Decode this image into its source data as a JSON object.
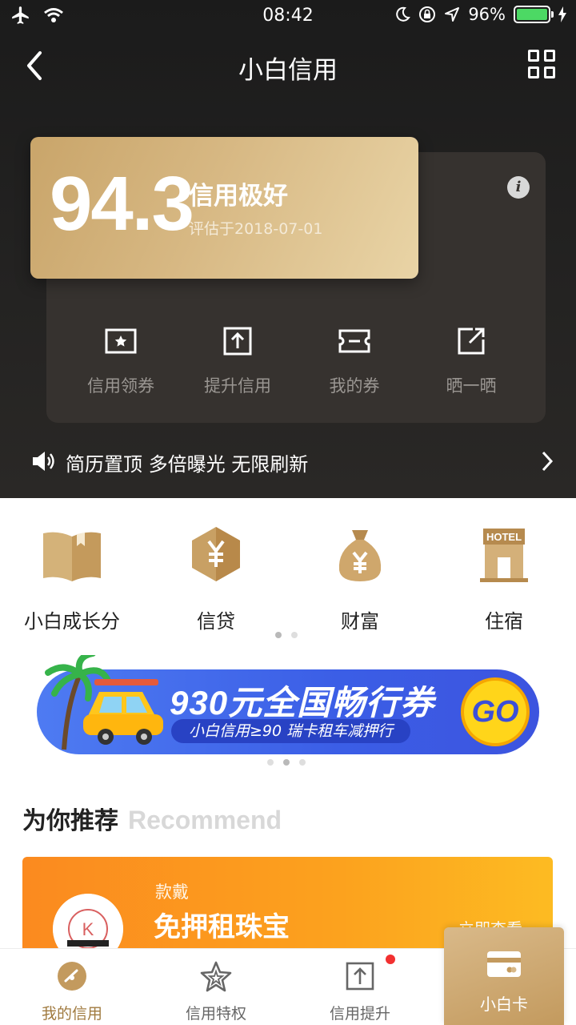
{
  "status_bar": {
    "time": "08:42",
    "battery": "96%"
  },
  "nav": {
    "title": "小白信用"
  },
  "credit": {
    "score": "94.3",
    "grade": "信用极好",
    "evaluated": "评估于2018-07-01"
  },
  "actions": [
    {
      "label": "信用领券",
      "icon": "coupon-star-icon"
    },
    {
      "label": "提升信用",
      "icon": "upload-icon"
    },
    {
      "label": "我的券",
      "icon": "ticket-icon"
    },
    {
      "label": "晒一晒",
      "icon": "share-icon"
    }
  ],
  "notice": {
    "text": "简历置顶 多倍曝光 无限刷新"
  },
  "services": [
    {
      "label": "小白成长分",
      "icon": "book-icon"
    },
    {
      "label": "信贷",
      "icon": "yuan-hexagon-icon"
    },
    {
      "label": "财富",
      "icon": "money-bag-icon"
    },
    {
      "label": "住宿",
      "icon": "hotel-icon",
      "sign": "HOTEL"
    }
  ],
  "banner": {
    "title": "930元全国畅行券",
    "subtitle": "小白信用≥90 瑞卡租车减押行",
    "button": "GO"
  },
  "recommend": {
    "title": "为你推荐",
    "title_en": "Recommend",
    "card": {
      "brand": "款戴",
      "name": "免押租珠宝",
      "action": "立即查看",
      "logo_letter": "K"
    }
  },
  "tabbar": {
    "items": [
      {
        "label": "我的信用",
        "active": true
      },
      {
        "label": "信用特权",
        "active": false
      },
      {
        "label": "信用提升",
        "active": false,
        "badge": true
      },
      {
        "label": "小白卡",
        "active": false
      }
    ]
  },
  "colors": {
    "gold": "#c9a56a",
    "dark": "#1b1b1b",
    "banner_blue": "#3b5ee6",
    "orange": "#fb8a1f",
    "active_tab": "#a07a3f"
  }
}
